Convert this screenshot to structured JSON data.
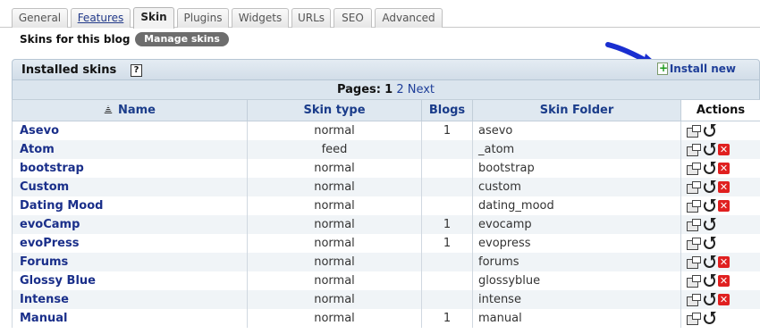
{
  "tabs": [
    "General",
    "Features",
    "Skin",
    "Plugins",
    "Widgets",
    "URLs",
    "SEO",
    "Advanced"
  ],
  "subnav": {
    "label": "Skins for this blog",
    "manage_button": "Manage skins"
  },
  "panel": {
    "title": "Installed skins",
    "help_icon": "?",
    "install_label": "Install new",
    "pages_label": "Pages:",
    "current_page": "1",
    "next_page": "2",
    "next_label": "Next"
  },
  "table": {
    "headers": [
      "Name",
      "Skin type",
      "Blogs",
      "Skin Folder",
      "Actions"
    ],
    "rows": [
      {
        "name": "Asevo",
        "type": "normal",
        "blogs": "1",
        "folder": "asevo",
        "deletable": false
      },
      {
        "name": "Atom",
        "type": "feed",
        "blogs": "",
        "folder": "_atom",
        "deletable": true
      },
      {
        "name": "bootstrap",
        "type": "normal",
        "blogs": "",
        "folder": "bootstrap",
        "deletable": true
      },
      {
        "name": "Custom",
        "type": "normal",
        "blogs": "",
        "folder": "custom",
        "deletable": true
      },
      {
        "name": "Dating Mood",
        "type": "normal",
        "blogs": "",
        "folder": "dating_mood",
        "deletable": true
      },
      {
        "name": "evoCamp",
        "type": "normal",
        "blogs": "1",
        "folder": "evocamp",
        "deletable": false
      },
      {
        "name": "evoPress",
        "type": "normal",
        "blogs": "1",
        "folder": "evopress",
        "deletable": false
      },
      {
        "name": "Forums",
        "type": "normal",
        "blogs": "",
        "folder": "forums",
        "deletable": true
      },
      {
        "name": "Glossy Blue",
        "type": "normal",
        "blogs": "",
        "folder": "glossyblue",
        "deletable": true
      },
      {
        "name": "Intense",
        "type": "normal",
        "blogs": "",
        "folder": "intense",
        "deletable": true
      },
      {
        "name": "Manual",
        "type": "normal",
        "blogs": "1",
        "folder": "manual",
        "deletable": false
      }
    ]
  },
  "colors": {
    "link": "#1a2f8a",
    "header_bg": "#dfe8f0",
    "delete": "#e02020",
    "arrow": "#1a2fd0"
  },
  "icons": {
    "edit": "properties-icon",
    "reload": "reload-icon",
    "delete": "delete-icon",
    "sort": "sort-asc-icon",
    "add": "add-file-icon"
  }
}
